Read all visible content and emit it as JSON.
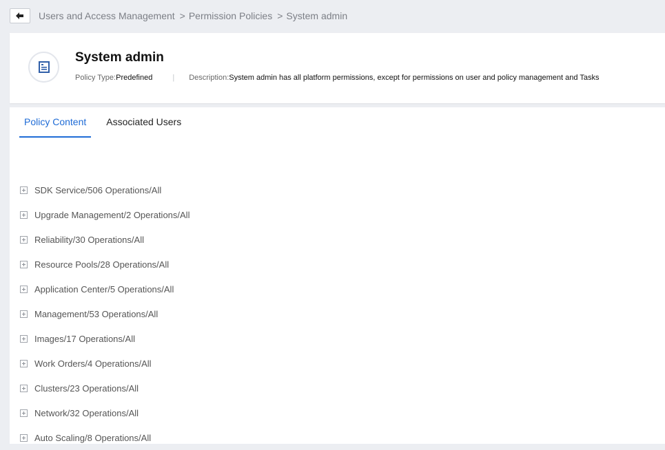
{
  "breadcrumb": {
    "items": [
      "Users and Access Management",
      "Permission Policies",
      "System admin"
    ],
    "separator": ">"
  },
  "policy": {
    "title": "System admin",
    "type_label": "Policy Type:",
    "type_value": "Predefined",
    "divider": "|",
    "description_label": "Description:",
    "description_value": "System admin has all platform permissions, except for permissions on user and policy management and Tasks",
    "icon": "document-list-icon"
  },
  "tabs": [
    {
      "label": "Policy Content",
      "active": true
    },
    {
      "label": "Associated Users",
      "active": false
    }
  ],
  "policy_items": [
    "SDK Service/506 Operations/All",
    "Upgrade Management/2 Operations/All",
    "Reliability/30 Operations/All",
    "Resource Pools/28 Operations/All",
    "Application Center/5 Operations/All",
    "Management/53 Operations/All",
    "Images/17 Operations/All",
    "Work Orders/4 Operations/All",
    "Clusters/23 Operations/All",
    "Network/32 Operations/All",
    "Auto Scaling/8 Operations/All"
  ],
  "colors": {
    "accent": "#1e6bd6",
    "page_background": "#eceef2",
    "card_background": "#ffffff"
  }
}
